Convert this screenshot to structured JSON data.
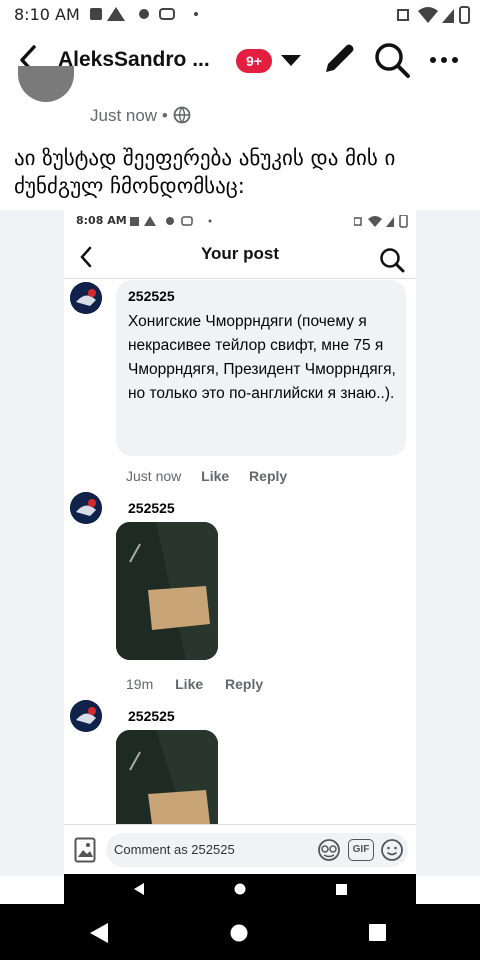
{
  "status_bar": {
    "time": "8:10 AM"
  },
  "header": {
    "title": "AleksSandro ...",
    "badge": "9+"
  },
  "post": {
    "meta_time": "Just now",
    "caption": "აი ზუსტად შეეფერება ანუკის და მის ი ძუნძგულ ჩმონდომსაც:"
  },
  "embedded": {
    "status_time": "8:08 AM",
    "title": "Your post",
    "comments": [
      {
        "author": "252525",
        "text": "Хонигские Чморрндяги (почему я некрасивее тейлор свифт, мне 75 я Чморрндягя, Президент Чморрндягя, но только это по-английски я знаю..).",
        "time": "Just now",
        "like": "Like",
        "reply": "Reply"
      },
      {
        "author": "252525",
        "time": "19m",
        "like": "Like",
        "reply": "Reply"
      },
      {
        "author": "252525"
      }
    ],
    "composer_placeholder": "Comment as 252525",
    "gif_label": "GIF"
  },
  "icons": {
    "back": "back-arrow-icon",
    "dropdown": "caret-down-icon",
    "edit": "pencil-icon",
    "search": "search-icon",
    "more": "more-dots-icon",
    "globe": "globe-icon"
  },
  "colors": {
    "badge": "#e41e3f",
    "meta": "#65676b",
    "nav": "#000000"
  }
}
